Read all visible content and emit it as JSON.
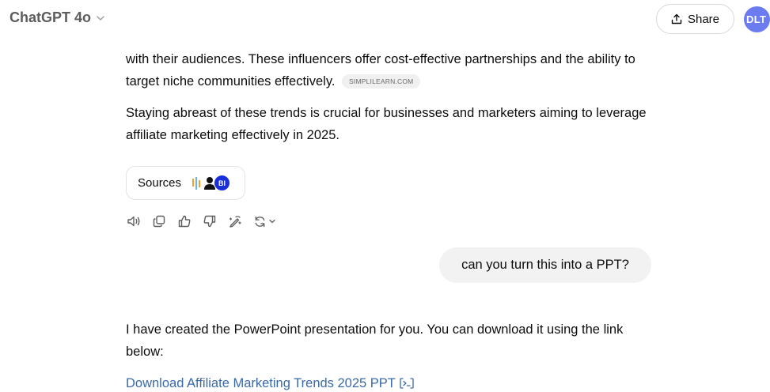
{
  "header": {
    "model_name": "ChatGPT 4o",
    "share_label": "Share",
    "avatar_initials": "DLT"
  },
  "assistant_message_1": {
    "paragraph_1": "with their audiences. These influencers offer cost-effective partnerships and the ability to target niche communities effectively.",
    "citation": "SIMPLILEARN.COM",
    "paragraph_2": "Staying abreast of these trends is crucial for businesses and marketers aiming to leverage affiliate marketing effectively in 2025.",
    "sources_label": "Sources",
    "source_badge": "BI"
  },
  "user_message": {
    "text": "can you turn this into a PPT?"
  },
  "assistant_message_2": {
    "paragraph": "I have created the PowerPoint presentation for you. You can download it using the link below:",
    "download_link": "Download Affiliate Marketing Trends 2025 PPT"
  },
  "colors": {
    "link": "#3a6aa8",
    "avatar_bg": "#6b7cf0",
    "user_bubble_bg": "#f2f2f2"
  }
}
